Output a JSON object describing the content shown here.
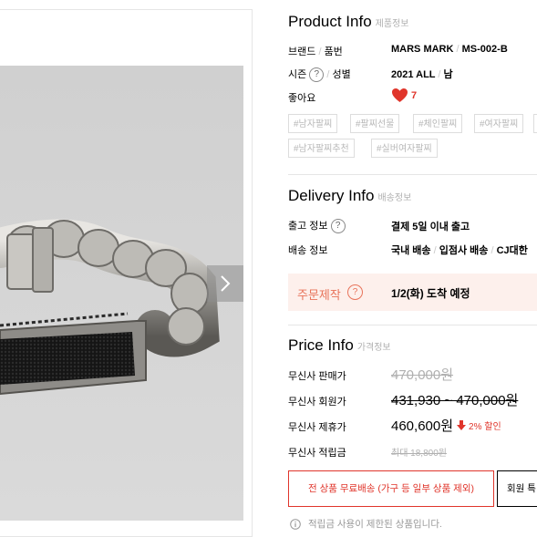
{
  "product_info": {
    "title": "Product Info",
    "subtitle": "제품정보",
    "brand_label_a": "브랜드",
    "brand_label_b": "품번",
    "brand_value_a": "MARS MARK",
    "brand_value_b": "MS-002-B",
    "season_label_a": "시즌",
    "season_label_b": "성별",
    "season_value_a": "2021 ALL",
    "season_value_b": "남",
    "like_label": "좋아요",
    "like_count": "7",
    "tags": [
      "#남자팔찌",
      "#팔찌선물",
      "#체인팔찌",
      "#여자팔찌",
      "#남자팔찌추천",
      "#실버여자팔찌"
    ]
  },
  "delivery_info": {
    "title": "Delivery Info",
    "subtitle": "배송정보",
    "ship_info_label": "출고 정보",
    "ship_info_value": "결제 5일 이내 출고",
    "delivery_label": "배송 정보",
    "delivery_value_a": "국내 배송",
    "delivery_value_b": "입점사 배송",
    "delivery_value_c": "CJ대한",
    "order_made_label": "주문제작",
    "order_made_value": "1/2(화) 도착 예정"
  },
  "price_info": {
    "title": "Price Info",
    "subtitle": "가격정보",
    "sale_label": "무신사 판매가",
    "sale_value": "470,000원",
    "member_label": "무신사 회원가",
    "member_value": "431,930 ~ 470,000원",
    "partner_label": "무신사 제휴가",
    "partner_value": "460,600원",
    "partner_discount": "2% 할인",
    "points_label": "무신사 적립금",
    "points_value": "최대 18,800원"
  },
  "buttons": {
    "free_shipping": "전 상품 무료배송 (가구 등 일부 상품 제외)",
    "member_benefit": "회원 특"
  },
  "points_notice": "적립금 사용이 제한된 상품입니다.",
  "help_glyph": "?",
  "colors": {
    "accent_red": "#e0352b",
    "notice_bg": "#fdf0ec",
    "notice_text": "#e8735a"
  }
}
